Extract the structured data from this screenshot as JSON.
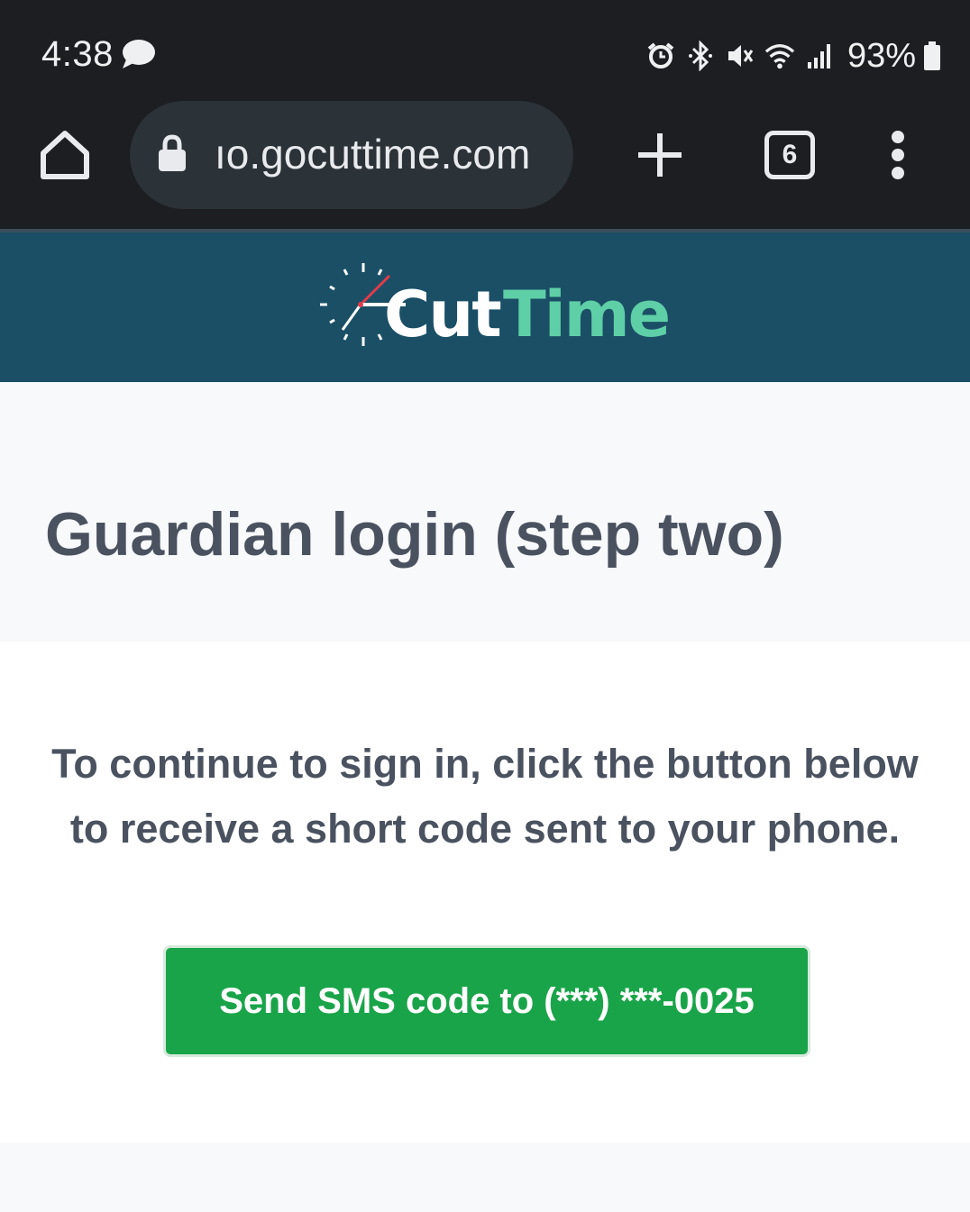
{
  "status_bar": {
    "time": "4:38",
    "left_icons": [
      "chat-bubble-icon"
    ],
    "right_icons": [
      "alarm-icon",
      "bluetooth-icon",
      "mute-icon",
      "wifi-icon",
      "signal-icon"
    ],
    "battery": "93%"
  },
  "browser": {
    "url": "ıo.gocuttime.com",
    "tab_count": "6",
    "icons": [
      "home-icon",
      "lock-icon",
      "plus-icon",
      "tabs-icon",
      "more-vert-icon"
    ]
  },
  "brand": {
    "logo_part1": "Cut",
    "logo_part2": "Time",
    "header_color": "#1a4f66",
    "accent_color": "#5ecfa6"
  },
  "page": {
    "title": "Guardian login (step two)",
    "instructions": "To continue to sign in, click the button below to receive a short code sent to your phone.",
    "sms_button_label": "Send SMS code to (***) ***-0025",
    "button_color": "#1aa44a"
  }
}
